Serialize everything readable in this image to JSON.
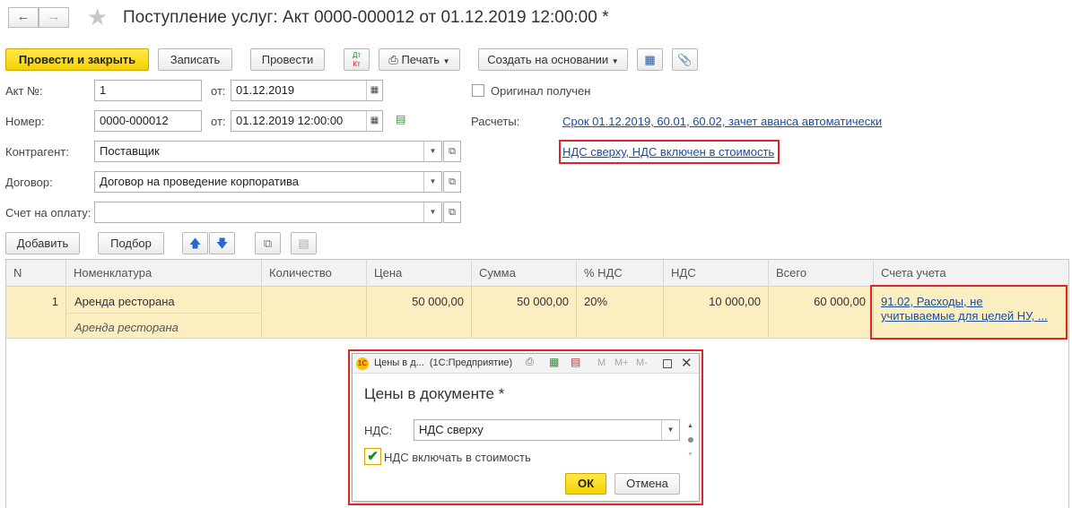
{
  "title": "Поступление услуг: Акт 0000-000012 от 01.12.2019 12:00:00 *",
  "toolbar": {
    "post_close": "Провести и закрыть",
    "save": "Записать",
    "post": "Провести",
    "print": "Печать",
    "create_based": "Создать на основании"
  },
  "form": {
    "act_label": "Акт №:",
    "act_value": "1",
    "from_label": "от:",
    "act_date": "01.12.2019",
    "number_label": "Номер:",
    "number_value": "0000-000012",
    "number_date": "01.12.2019 12:00:00",
    "original_label": "Оригинал получен",
    "counterparty_label": "Контрагент:",
    "counterparty_value": "Поставщик",
    "contract_label": "Договор:",
    "contract_value": "Договор на проведение корпоратива",
    "invoice_label": "Счет на оплату:",
    "invoice_value": "",
    "settlements_label": "Расчеты:",
    "settlements_link": "Срок 01.12.2019, 60.01, 60.02, зачет аванса автоматически",
    "vat_link": "НДС сверху, НДС включен в стоимость"
  },
  "table_toolbar": {
    "add": "Добавить",
    "pick": "Подбор"
  },
  "table": {
    "columns": [
      "N",
      "Номенклатура",
      "Количество",
      "Цена",
      "Сумма",
      "% НДС",
      "НДС",
      "Всего",
      "Счета учета"
    ],
    "rows": [
      {
        "n": "1",
        "item": "Аренда ресторана",
        "item_content": "Аренда ресторана",
        "qty": "",
        "price": "50 000,00",
        "sum": "50 000,00",
        "vat_rate": "20%",
        "vat": "10 000,00",
        "total": "60 000,00",
        "accounts": "91.02, Расходы, не учитываемые для целей НУ, ..."
      }
    ]
  },
  "dialog": {
    "window_title": "Цены в д...  (1С:Предприятие)",
    "heading": "Цены в документе *",
    "vat_label": "НДС:",
    "vat_value": "НДС сверху",
    "include_label": "НДС включать в стоимость",
    "include_checked": true,
    "ok": "ОК",
    "cancel": "Отмена",
    "m_buttons": [
      "M",
      "M+",
      "M-"
    ]
  },
  "colors": {
    "accent_yellow": "#f5d200",
    "selected_row": "#fbeec0",
    "link": "#1a4d9c",
    "highlight_red": "#d9262a"
  }
}
